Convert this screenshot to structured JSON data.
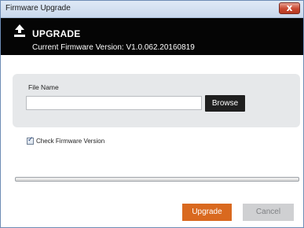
{
  "window": {
    "title": "Firmware Upgrade",
    "close_glyph": "x"
  },
  "header": {
    "icon": "upload-icon",
    "title": "UPGRADE",
    "version_text": "Current Firmware Version: V1.0.062.20160819"
  },
  "file_panel": {
    "label": "File Name",
    "input_value": "",
    "input_placeholder": "",
    "browse_label": "Browse"
  },
  "check_version": {
    "label": "Check Firmware Version",
    "checked": true
  },
  "progress": {
    "value_percent": 0
  },
  "actions": {
    "upgrade_label": "Upgrade",
    "cancel_label": "Cancel"
  },
  "colors": {
    "header_bg": "#050505",
    "accent_upgrade": "#d9691f",
    "disabled_button": "#cfd0d2",
    "browse_bg": "#1f1f1f",
    "close_button": "#c9482f"
  }
}
